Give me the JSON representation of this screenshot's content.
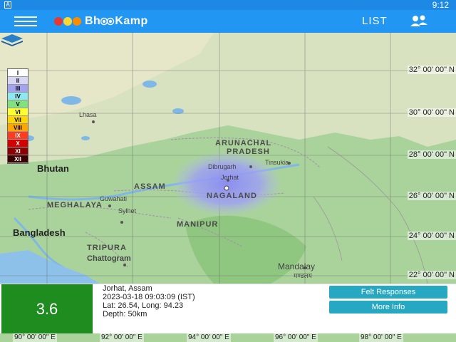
{
  "status_bar": {
    "time": "9:12",
    "left_icon": "A"
  },
  "app_bar": {
    "brand_prefix": "Bh",
    "brand_suffix": "Kamp",
    "list_label": "LIST",
    "icons": {
      "menu": "hamburger-icon",
      "people": "people-icon",
      "globe": "globe-icon"
    },
    "logo_colors": [
      "#e53935",
      "#fdd835",
      "#fb8c00"
    ]
  },
  "map": {
    "countries": [
      "Bhutan",
      "Bangladesh"
    ],
    "states": [
      "ARUNACHAL",
      "PRADESH",
      "ASSAM",
      "NAGALAND",
      "MEGHALAYA",
      "MANIPUR",
      "TRIPURA"
    ],
    "cities": [
      "Lhasa",
      "Dibrugarh",
      "Tinsukia",
      "Jorhat",
      "Guwahati",
      "Sylhet",
      "Chattogram",
      "Mandalay",
      "मण्डलय"
    ],
    "latitudes": [
      "32° 00' 00\" N",
      "30° 00' 00\" N",
      "28° 00' 00\" N",
      "26° 00' 00\" N",
      "24° 00' 00\" N",
      "22° 00' 00\" N"
    ],
    "longitudes": [
      "90° 00' 00\" E",
      "92° 00' 00\" E",
      "94° 00' 00\" E",
      "96° 00' 00\" E",
      "98° 00' 00\" E"
    ],
    "legend": [
      {
        "label": "I",
        "color": "#ffffff"
      },
      {
        "label": "II",
        "color": "#d7d7f5"
      },
      {
        "label": "III",
        "color": "#a3a3f0"
      },
      {
        "label": "IV",
        "color": "#8ee8f0"
      },
      {
        "label": "V",
        "color": "#7fe27f"
      },
      {
        "label": "VI",
        "color": "#ffff33"
      },
      {
        "label": "VII",
        "color": "#ffd700"
      },
      {
        "label": "VIII",
        "color": "#ffa500"
      },
      {
        "label": "IX",
        "color": "#ff3b1f"
      },
      {
        "label": "X",
        "color": "#d00000"
      },
      {
        "label": "XI",
        "color": "#8b0000"
      },
      {
        "label": "XII",
        "color": "#3a0000"
      }
    ],
    "layers_icon": "layers-icon"
  },
  "event": {
    "magnitude": "3.6",
    "location": "Jorhat, Assam",
    "datetime": "2023-03-18 09:03:09 (IST)",
    "coords": "Lat: 26.54, Long: 94.23",
    "depth": "Depth: 50km",
    "magnitude_color": "#1e8c1e"
  },
  "buttons": {
    "felt": "Felt Responses",
    "more": "More Info",
    "color": "#26a7c2"
  }
}
